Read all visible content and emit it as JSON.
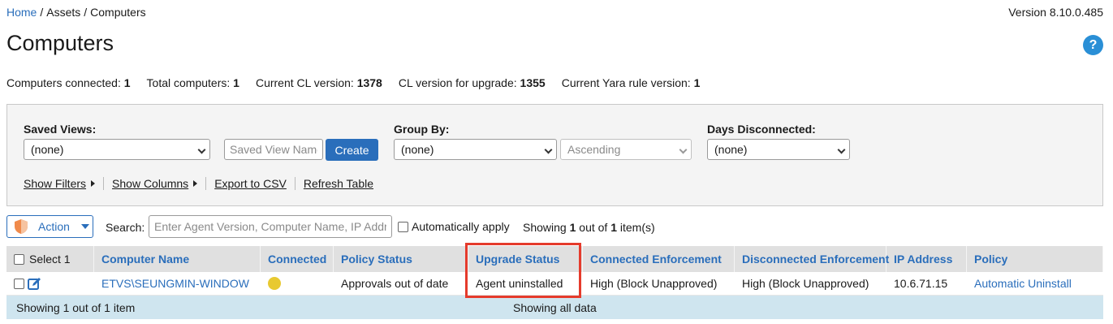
{
  "breadcrumb": {
    "home": "Home",
    "assets": "Assets",
    "current": "Computers",
    "separator": "/"
  },
  "version_text": "Version 8.10.0.485",
  "title": "Computers",
  "help_icon": "?",
  "stats": [
    {
      "label": "Computers connected:",
      "value": "1"
    },
    {
      "label": "Total computers:",
      "value": "1"
    },
    {
      "label": "Current CL version:",
      "value": "1378"
    },
    {
      "label": "CL version for upgrade:",
      "value": "1355"
    },
    {
      "label": "Current Yara rule version:",
      "value": "1"
    }
  ],
  "filters": {
    "saved_views_label": "Saved Views:",
    "saved_views_value": "(none)",
    "saved_view_name_placeholder": "Saved View Name",
    "create_label": "Create",
    "group_by_label": "Group By:",
    "group_by_value": "(none)",
    "order_value": "Ascending",
    "days_disconnected_label": "Days Disconnected:",
    "days_disconnected_value": "(none)",
    "links": {
      "show_filters": "Show Filters",
      "show_columns": "Show Columns",
      "export_csv": "Export to CSV",
      "refresh_table": "Refresh Table"
    }
  },
  "action_bar": {
    "action_label": "Action",
    "search_label": "Search:",
    "search_placeholder": "Enter Agent Version, Computer Name, IP Address",
    "auto_apply_label": "Automatically apply",
    "showing_prefix": "Showing",
    "showing_count": "1",
    "showing_suffix": "out of",
    "showing_total": "1",
    "showing_unit": "item(s)"
  },
  "table": {
    "select_label": "Select 1",
    "columns": [
      "Computer Name",
      "Connected",
      "Policy Status",
      "Upgrade Status",
      "Connected Enforcement",
      "Disconnected Enforcement",
      "IP Address",
      "Policy"
    ],
    "rows": [
      {
        "computer_name": "ETVS\\SEUNGMIN-WINDOW",
        "connected_status_color": "#e8c930",
        "policy_status": "Approvals out of date",
        "upgrade_status": "Agent uninstalled",
        "connected_enforcement": "High (Block Unapproved)",
        "disconnected_enforcement": "High (Block Unapproved)",
        "ip_address": "10.6.71.15",
        "policy": "Automatic Uninstall"
      }
    ],
    "footer_left": "Showing 1 out of 1 item",
    "footer_center": "Showing all data"
  },
  "colors": {
    "link": "#2a6ebb",
    "highlight": "#e53b2c",
    "footer_bg": "#cfe5ef",
    "header_bg": "#e0e0e0"
  }
}
